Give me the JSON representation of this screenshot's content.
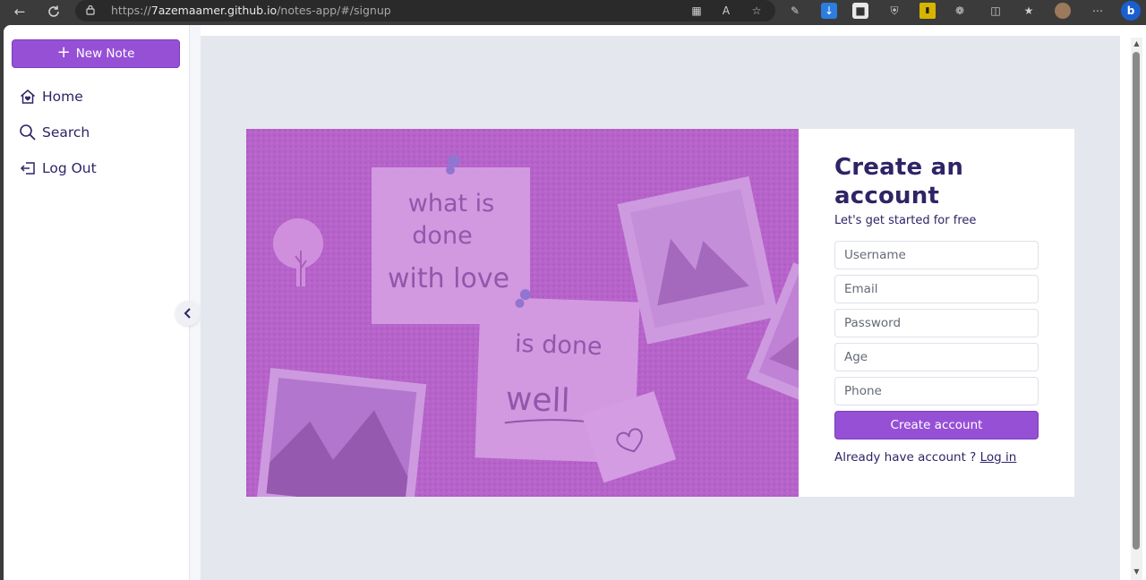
{
  "browser": {
    "url_prefix": "https://",
    "url_host": "7azemaamer.github.io",
    "url_path": "/notes-app/#/signup",
    "icons": [
      "back-icon",
      "refresh-icon",
      "lock-icon",
      "apps-icon",
      "read-aloud-icon",
      "favorite-icon",
      "extension-icon",
      "download-icon",
      "extensions-icon",
      "split-screen-icon",
      "favorites-icon",
      "profile-avatar",
      "more-icon",
      "bing-icon"
    ]
  },
  "sidebar": {
    "new_note_label": "New Note",
    "items": [
      {
        "label": "Home",
        "icon": "home-icon"
      },
      {
        "label": "Search",
        "icon": "search-icon"
      },
      {
        "label": "Log Out",
        "icon": "logout-icon"
      }
    ]
  },
  "hero": {
    "note1_line1": "what is",
    "note1_line2": "done",
    "note1_line3": "with love",
    "note2_line1": "is done",
    "note2_line2": "well"
  },
  "signup": {
    "title_line1": "Create an",
    "title_line2": "account",
    "subtitle": "Let's get started for free",
    "fields": {
      "username": "Username",
      "email": "Email",
      "password": "Password",
      "age": "Age",
      "phone": "Phone"
    },
    "submit_label": "Create account",
    "already_text": "Already have account ?",
    "login_link": "Log in"
  },
  "colors": {
    "accent": "#9650d6",
    "heading": "#2e2466",
    "page_bg": "#e5e7ef"
  }
}
